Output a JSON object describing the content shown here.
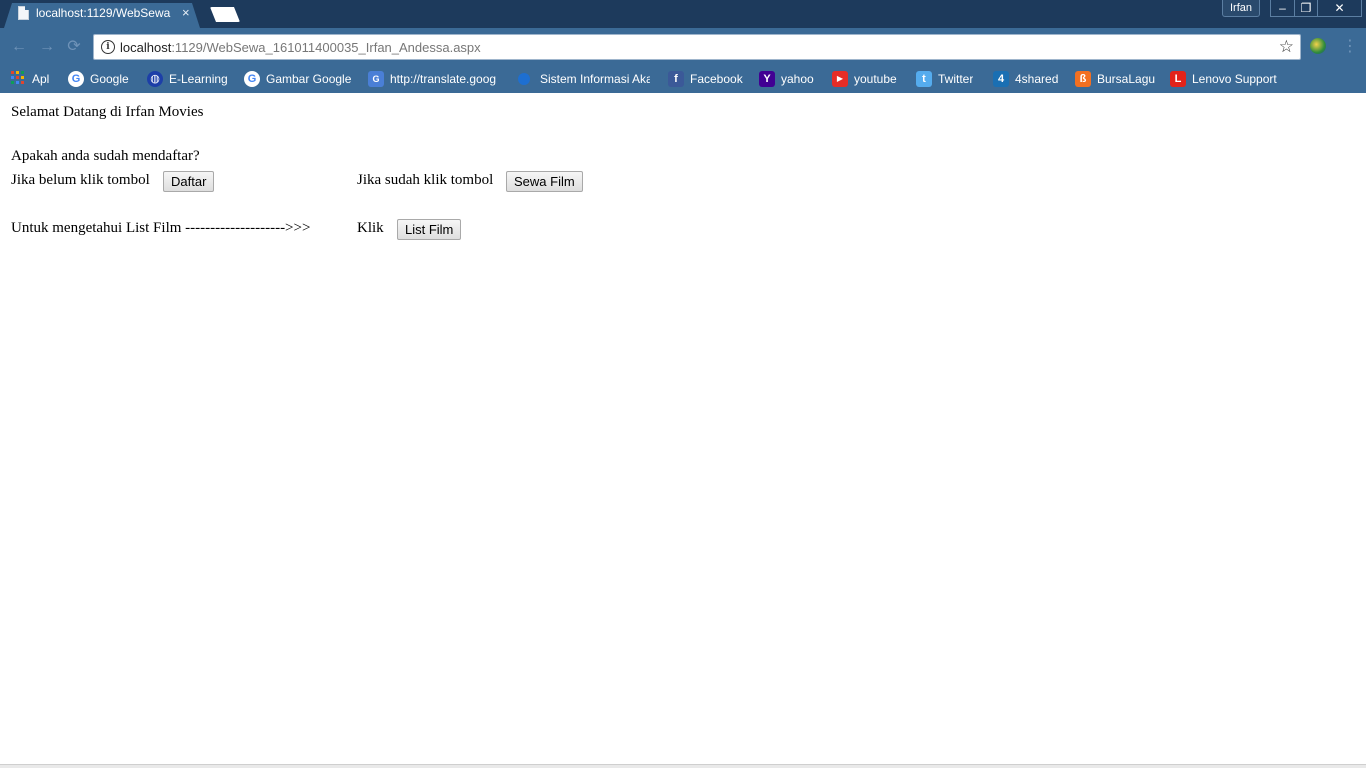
{
  "browser": {
    "tab": {
      "title": "localhost:1129/WebSewa",
      "close": "×"
    },
    "profile_name": "Irfan",
    "window_controls": {
      "minimize": "–",
      "maximize": "❐",
      "close": "✕"
    },
    "address": {
      "host": "localhost",
      "rest": ":1129/WebSewa_161011400035_Irfan_Andessa.aspx"
    },
    "bookmarks": [
      {
        "label": "Apl",
        "icon": "apps-grid-icon",
        "color": "#e0452f"
      },
      {
        "label": "Google",
        "icon": "google-icon",
        "color": "#ffffff"
      },
      {
        "label": "E-Learning",
        "icon": "globe-icon",
        "color": "#1d3fa8"
      },
      {
        "label": "Gambar Google",
        "icon": "google-icon",
        "color": "#ffffff"
      },
      {
        "label": "http://translate.goog",
        "icon": "translate-icon",
        "color": "#4a7fd6"
      },
      {
        "label": "Sistem Informasi Aka",
        "icon": "circle-icon",
        "color": "#1e6fd1"
      },
      {
        "label": "Facebook",
        "icon": "facebook-icon",
        "color": "#3b5998"
      },
      {
        "label": "yahoo",
        "icon": "yahoo-icon",
        "color": "#410093"
      },
      {
        "label": "youtube",
        "icon": "youtube-icon",
        "color": "#e52d27"
      },
      {
        "label": "Twitter",
        "icon": "twitter-icon",
        "color": "#55acee"
      },
      {
        "label": "4shared",
        "icon": "4shared-icon",
        "color": "#1a6fb3"
      },
      {
        "label": "BursaLagu",
        "icon": "bursalagu-icon",
        "color": "#f37021"
      },
      {
        "label": "Lenovo Support",
        "icon": "lenovo-icon",
        "color": "#e2231a"
      }
    ]
  },
  "page": {
    "welcome": "Selamat Datang di Irfan Movies",
    "question": "Apakah anda sudah mendaftar?",
    "not_registered_text": "Jika belum klik tombol",
    "register_button": "Daftar",
    "registered_text": "Jika sudah klik tombol",
    "rent_button": "Sewa Film",
    "list_text": "Untuk mengetahui List Film -------------------->>>",
    "click_text": "Klik",
    "list_button": "List Film"
  }
}
